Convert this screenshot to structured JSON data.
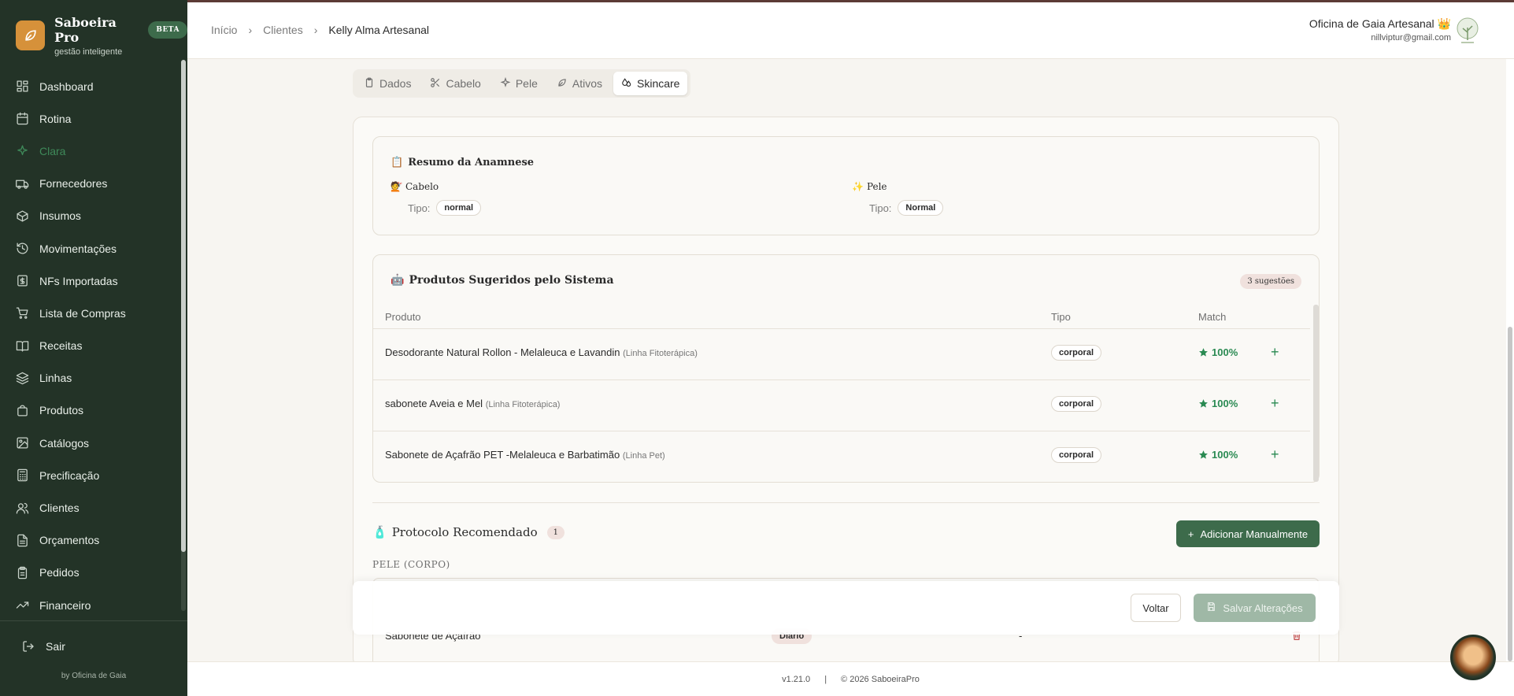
{
  "brand": {
    "name": "Saboeira Pro",
    "badge": "BETA",
    "subtitle": "gestão inteligente",
    "footer": "by Oficina de Gaia"
  },
  "sidebar": {
    "items": [
      {
        "label": "Dashboard",
        "icon": "dashboard-icon"
      },
      {
        "label": "Rotina",
        "icon": "calendar-icon"
      },
      {
        "label": "Clara",
        "icon": "sparkle-icon",
        "active": true
      },
      {
        "label": "Fornecedores",
        "icon": "truck-icon"
      },
      {
        "label": "Insumos",
        "icon": "box-icon"
      },
      {
        "label": "Movimentações",
        "icon": "history-icon"
      },
      {
        "label": "NFs Importadas",
        "icon": "receipt-icon"
      },
      {
        "label": "Lista de Compras",
        "icon": "cart-icon"
      },
      {
        "label": "Receitas",
        "icon": "book-icon"
      },
      {
        "label": "Linhas",
        "icon": "layers-icon"
      },
      {
        "label": "Produtos",
        "icon": "bag-icon"
      },
      {
        "label": "Catálogos",
        "icon": "image-icon"
      },
      {
        "label": "Precificação",
        "icon": "calculator-icon"
      },
      {
        "label": "Clientes",
        "icon": "users-icon"
      },
      {
        "label": "Orçamentos",
        "icon": "document-icon"
      },
      {
        "label": "Pedidos",
        "icon": "clipboard-icon"
      },
      {
        "label": "Financeiro",
        "icon": "trending-icon"
      }
    ],
    "logout": "Sair"
  },
  "header": {
    "breadcrumb": [
      "Início",
      "Clientes",
      "Kelly Alma Artesanal"
    ],
    "user_name": "Oficina de Gaia Artesanal",
    "user_crown": "👑",
    "user_email": "nillviptur@gmail.com"
  },
  "tabs": [
    {
      "label": "Dados",
      "icon": "clipboard-icon"
    },
    {
      "label": "Cabelo",
      "icon": "scissors-icon"
    },
    {
      "label": "Pele",
      "icon": "sparkle-icon"
    },
    {
      "label": "Ativos",
      "icon": "leaf-icon"
    },
    {
      "label": "Skincare",
      "icon": "droplets-icon",
      "active": true
    }
  ],
  "anamnese": {
    "title": "Resumo da Anamnese",
    "title_icon": "📋",
    "cabelo": {
      "label": "Cabelo",
      "icon": "💇",
      "tipo_label": "Tipo:",
      "tipo": "normal"
    },
    "pele": {
      "label": "Pele",
      "icon": "✨",
      "tipo_label": "Tipo:",
      "tipo": "Normal"
    }
  },
  "sugeridos": {
    "title": "Produtos Sugeridos pelo Sistema",
    "title_icon": "🤖",
    "count": "3 sugestões",
    "columns": [
      "Produto",
      "Tipo",
      "Match"
    ],
    "rows": [
      {
        "produto": "Desodorante Natural Rollon - Melaleuca e Lavandin",
        "linha": "(Linha Fitoterápica)",
        "tipo": "corporal",
        "match": "100%"
      },
      {
        "produto": "sabonete Aveia e Mel",
        "linha": "(Linha Fitoterápica)",
        "tipo": "corporal",
        "match": "100%"
      },
      {
        "produto": "Sabonete de Açafrão PET -Melaleuca e Barbatimão",
        "linha": "(Linha Pet)",
        "tipo": "corporal",
        "match": "100%"
      }
    ]
  },
  "protocolo": {
    "title": "Protocolo Recomendado",
    "title_icon": "🧴",
    "count": "1",
    "add_label": "Adicionar Manualmente",
    "group": "PELE (CORPO)",
    "rows": [
      {
        "produto": "Sabonete de Açafrão",
        "frequencia": "Diário",
        "obs": "-"
      }
    ]
  },
  "actions": {
    "back": "Voltar",
    "save": "Salvar Alterações"
  },
  "footer": {
    "version": "v1.21.0",
    "sep": "|",
    "copyright": "© 2026 SaboeiraPro"
  },
  "colors": {
    "sidebar": "#233327",
    "accent": "#3d6b4b",
    "match": "#2a8a52",
    "logo": "#d6913a"
  }
}
